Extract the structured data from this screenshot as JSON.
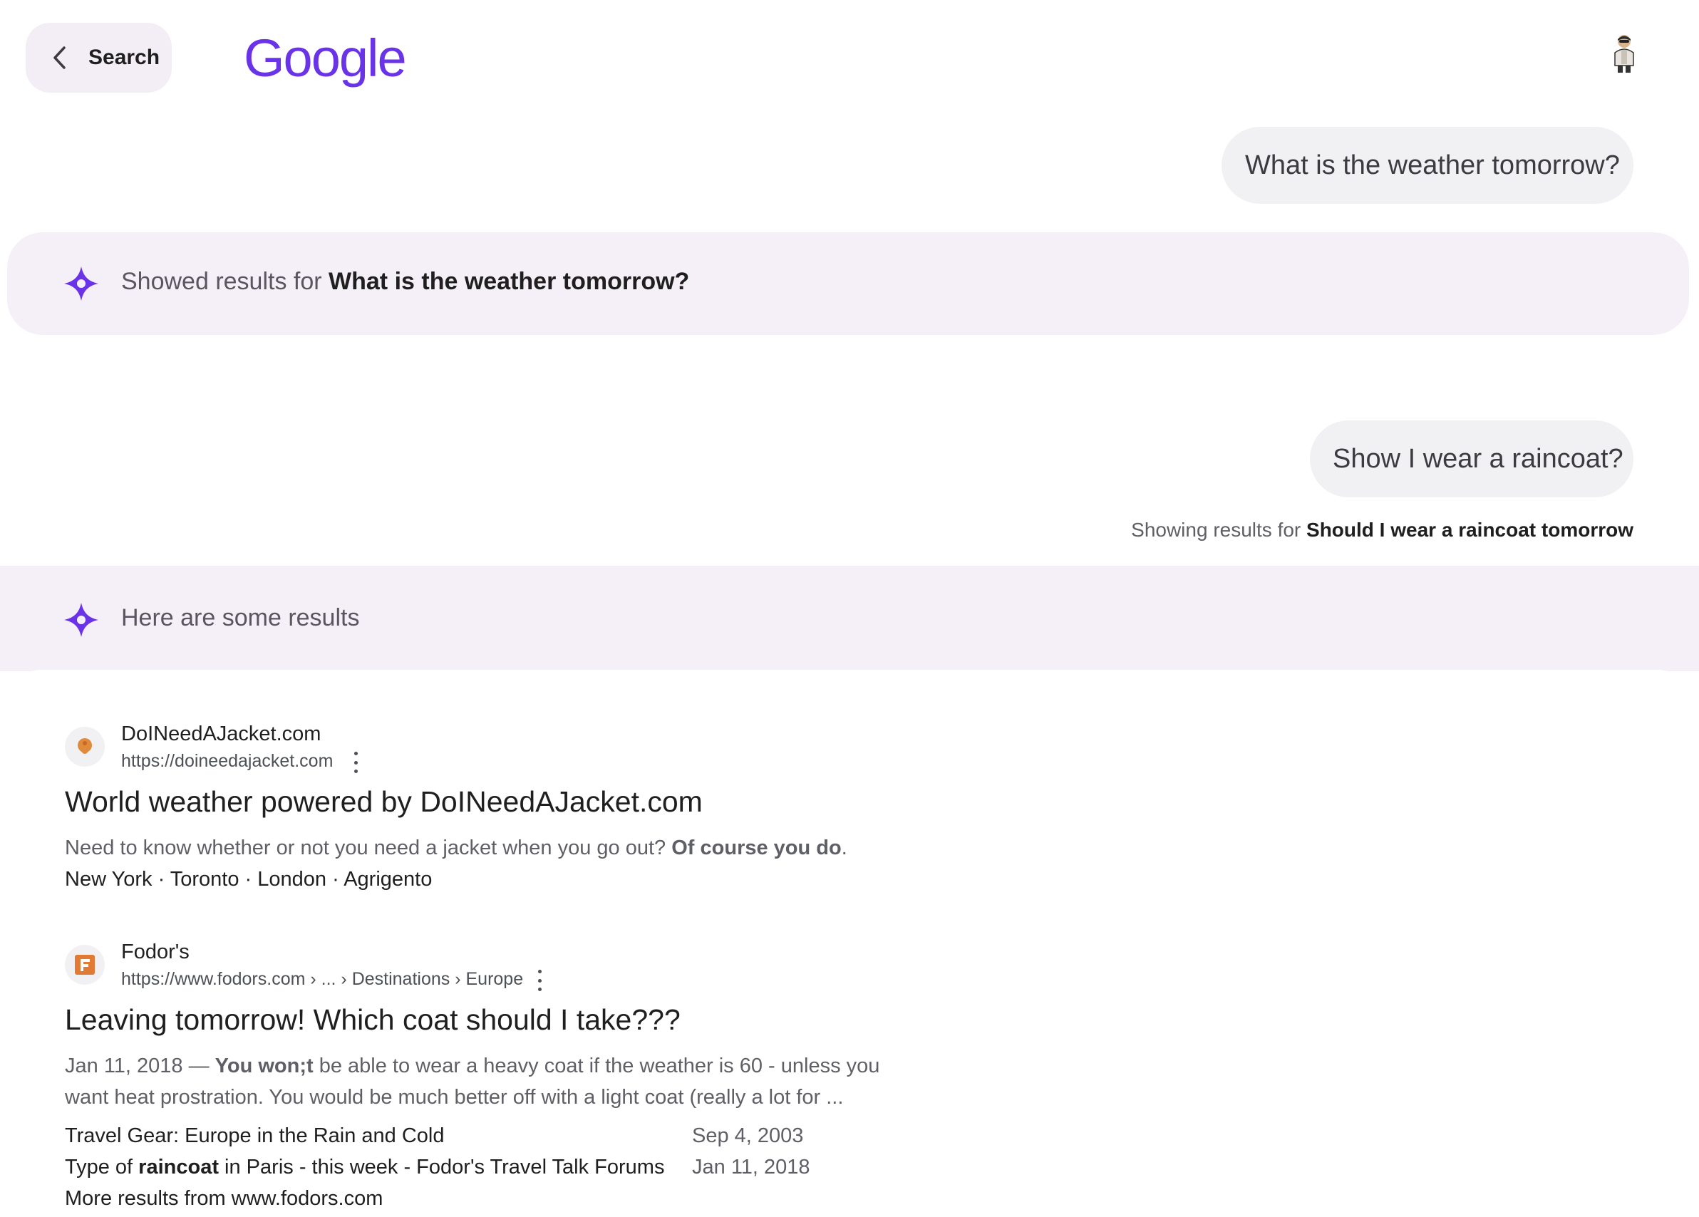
{
  "header": {
    "back_label": "Search",
    "logo_text": "Google"
  },
  "conversation": {
    "query_1": "What is the weather tomorrow?",
    "band_1_prefix": "Showed results for ",
    "band_1_query": "What is the weather tomorrow?",
    "query_2": "Show I wear a raincoat?",
    "showing_prefix": "Showing results for ",
    "showing_query": "Should I wear a raincoat tomorrow",
    "band_2_text": "Here are some results"
  },
  "results": [
    {
      "site_name": "DoINeedAJacket.com",
      "url": "https://doineedajacket.com",
      "title": "World weather powered by DoINeedAJacket.com",
      "snippet_plain": "Need to know whether or not you need a jacket when you go out? ",
      "snippet_bold": "Of course you do",
      "snippet_end": ".",
      "links": "New York · Toronto · London · Agrigento"
    },
    {
      "site_name": "Fodor's",
      "url": "https://www.fodors.com › ... › Destinations › Europe",
      "title": "Leaving tomorrow! Which coat should I take???",
      "snippet_date": "Jan 11, 2018 — ",
      "snippet_bold": "You won;t",
      "snippet_rest": " be able to wear a heavy coat if the weather is 60 - unless you want heat prostration. You would be much better off with a light coat (really a lot for ...",
      "sublinks": [
        {
          "pre": "Travel Gear: Europe in the Rain and Cold",
          "bold": "",
          "post": "",
          "date": "Sep 4, 2003"
        },
        {
          "pre": "Type of ",
          "bold": "raincoat",
          "post": " in Paris - this week - Fodor's Travel Talk Forums",
          "date": "Jan 11, 2018"
        }
      ],
      "more": "More results from www.fodors.com"
    }
  ],
  "colors": {
    "accent": "#6a33e8",
    "band_bg": "#f5f0f8",
    "bubble_bg": "#f1f1f3"
  }
}
